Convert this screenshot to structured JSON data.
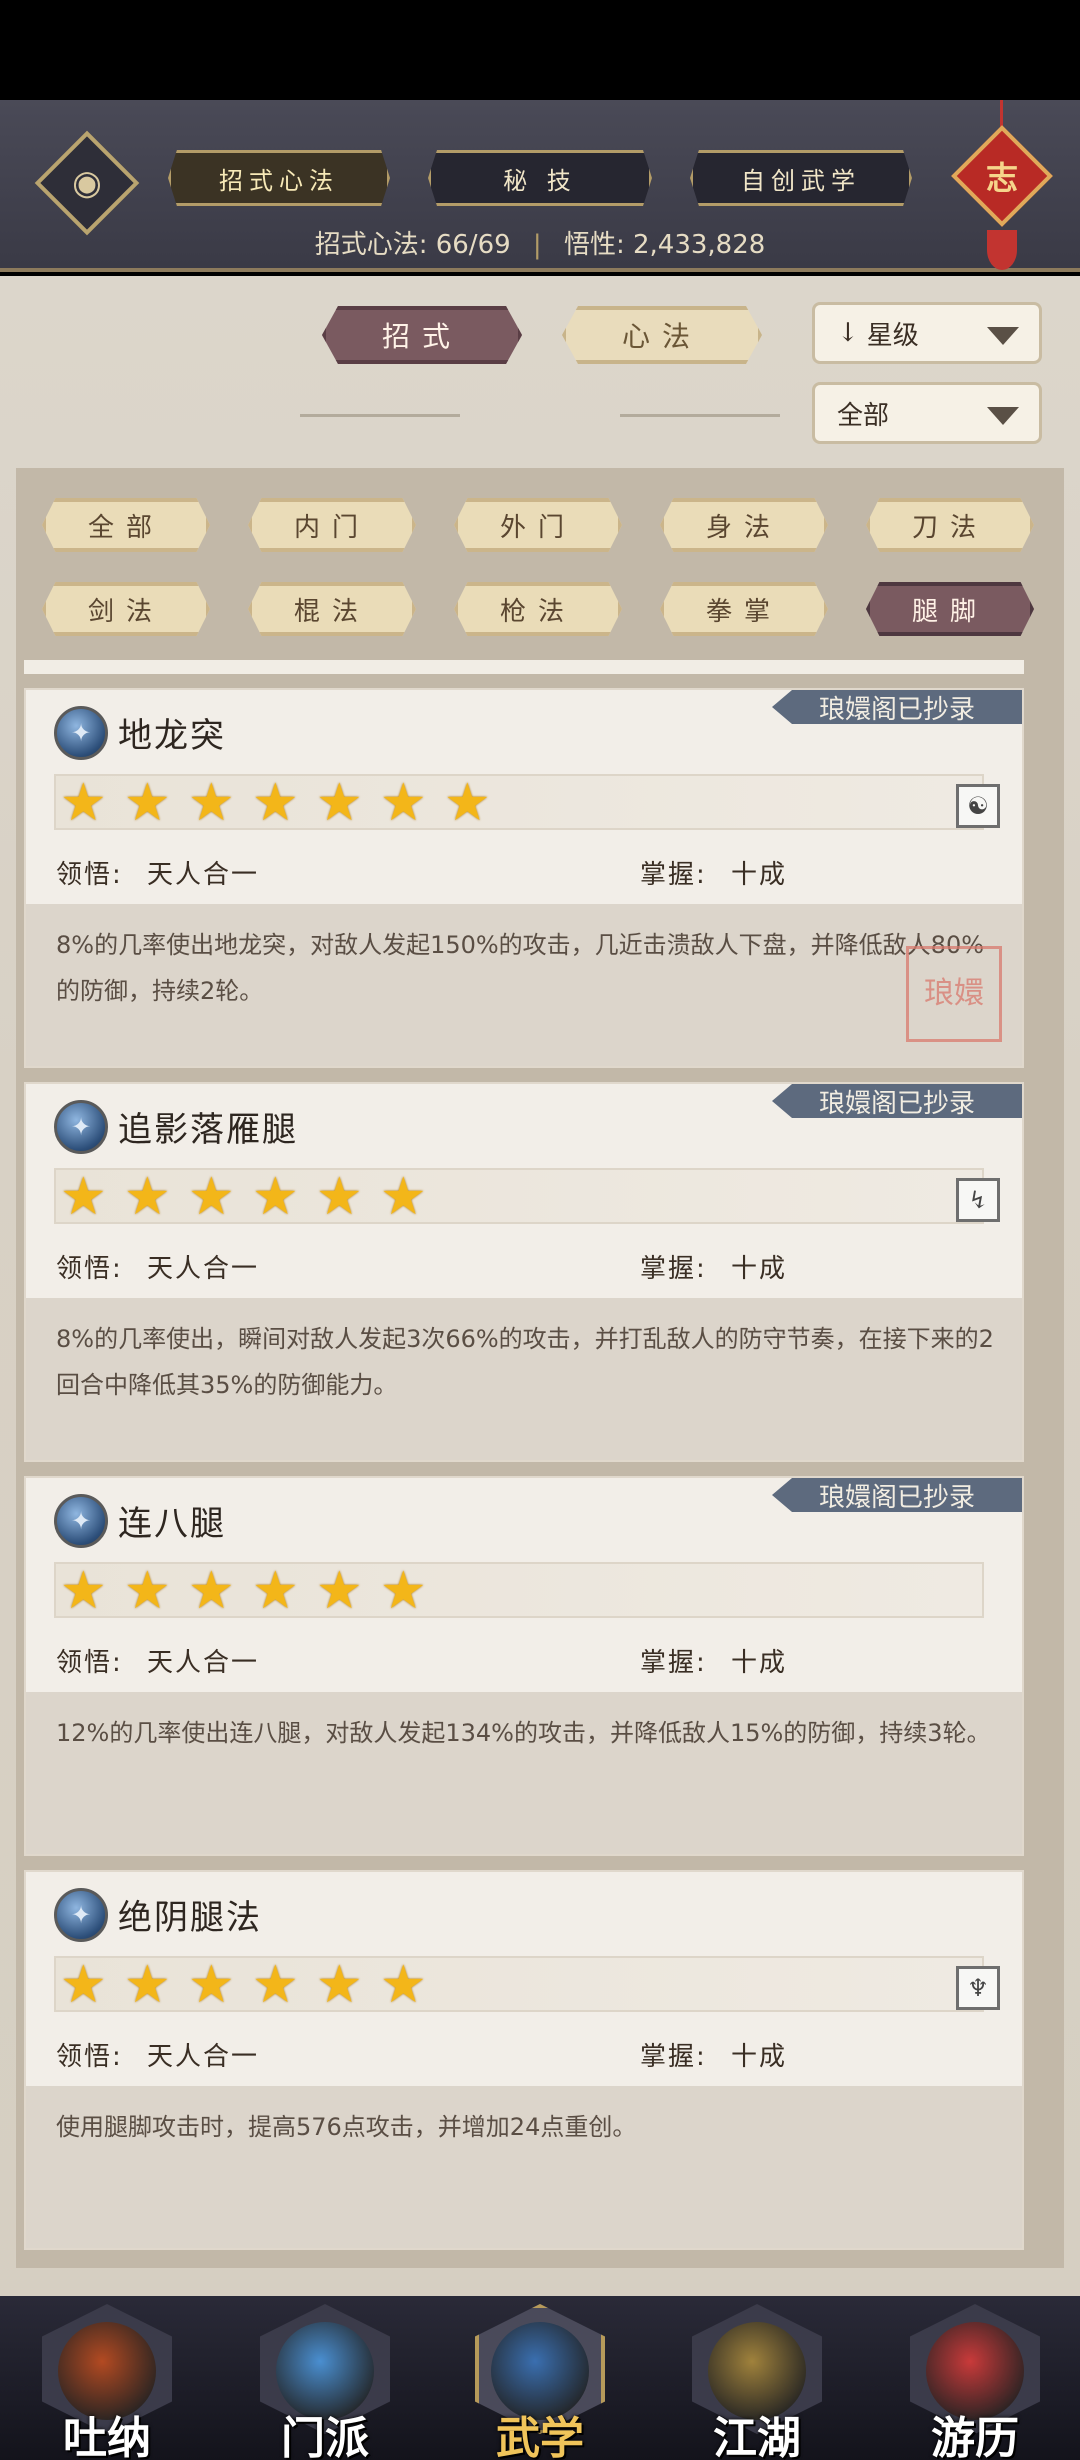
{
  "header": {
    "tabs": [
      {
        "label": "招式心法",
        "active": true
      },
      {
        "label": "秘 技",
        "active": false
      },
      {
        "label": "自创武学",
        "active": false
      }
    ],
    "stats": {
      "collected_label": "招式心法:",
      "collected_value": "66/69",
      "insight_label": "悟性:",
      "insight_value": "2,433,828"
    },
    "charm_char": "志"
  },
  "category_tabs": [
    {
      "label": "招式",
      "active": true
    },
    {
      "label": "心法",
      "active": false
    }
  ],
  "sort_dropdown": {
    "value": "星级",
    "arrow": "↓"
  },
  "filter_dropdown": {
    "value": "全部"
  },
  "filters": [
    {
      "label": "全部",
      "active": false
    },
    {
      "label": "内门",
      "active": false
    },
    {
      "label": "外门",
      "active": false
    },
    {
      "label": "身法",
      "active": false
    },
    {
      "label": "刀法",
      "active": false
    },
    {
      "label": "剑法",
      "active": false
    },
    {
      "label": "棍法",
      "active": false
    },
    {
      "label": "枪法",
      "active": false
    },
    {
      "label": "拳掌",
      "active": false
    },
    {
      "label": "腿脚",
      "active": true
    }
  ],
  "skills": [
    {
      "name": "地龙突",
      "badge": "琅嬛阁已抄录",
      "stars": 7,
      "type_icon": "scroll-icon",
      "comprehension_label": "领悟:",
      "comprehension": "天人合一",
      "mastery_label": "掌握:",
      "mastery": "十成",
      "desc": "8%的几率使出地龙突，对敌人发起150%的攻击，几近击溃敌人下盘，并降低敌人80%的防御，持续2轮。",
      "seal": "琅嬛"
    },
    {
      "name": "追影落雁腿",
      "badge": "琅嬛阁已抄录",
      "stars": 6,
      "type_icon": "kick-icon",
      "comprehension_label": "领悟:",
      "comprehension": "天人合一",
      "mastery_label": "掌握:",
      "mastery": "十成",
      "desc": "8%的几率使出，瞬间对敌人发起3次66%的攻击，并打乱敌人的防守节奏，在接下来的2回合中降低其35%的防御能力。"
    },
    {
      "name": "连八腿",
      "badge": "琅嬛阁已抄录",
      "stars": 6,
      "type_icon": "none",
      "comprehension_label": "领悟:",
      "comprehension": "天人合一",
      "mastery_label": "掌握:",
      "mastery": "十成",
      "desc": "12%的几率使出连八腿，对敌人发起134%的攻击，并降低敌人15%的防御，持续3轮。"
    },
    {
      "name": "绝阴腿法",
      "badge": "",
      "stars": 6,
      "type_icon": "claw-icon",
      "comprehension_label": "领悟:",
      "comprehension": "天人合一",
      "mastery_label": "掌握:",
      "mastery": "十成",
      "desc": "使用腿脚攻击时，提高576点攻击，并增加24点重创。"
    }
  ],
  "bottom_nav": [
    {
      "label": "吐纳",
      "active": false,
      "color": "#b34a22"
    },
    {
      "label": "门派",
      "active": false,
      "color": "#4a8fd1"
    },
    {
      "label": "武学",
      "active": true,
      "color": "#3a6fb0"
    },
    {
      "label": "江湖",
      "active": false,
      "color": "#a0823c"
    },
    {
      "label": "游历",
      "active": false,
      "color": "#c93a3a"
    }
  ]
}
